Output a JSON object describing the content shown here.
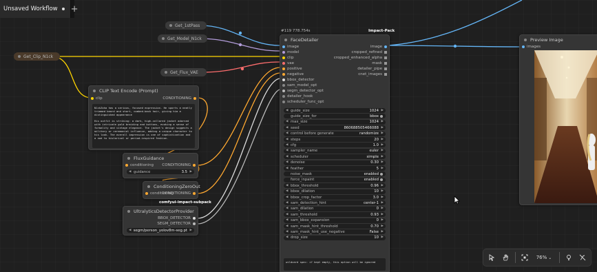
{
  "tab": {
    "title": "Unsaved Workflow",
    "add": "+"
  },
  "nodes": {
    "get_1stpass": {
      "title": "Get_1stPass"
    },
    "get_model": {
      "title": "Get_Model_N1ck"
    },
    "get_clip": {
      "title": "Get_Clip_N1ck"
    },
    "get_vae": {
      "title": "Get_Flux_VAE"
    },
    "clip_text": {
      "title": "CLIP Text Encode (Prompt)",
      "input": "clip",
      "output": "CONDITIONING",
      "text_p1": "N1ckZoha has a serious, focused expression. He sports a neatly trimmed beard and short, combed-back hair, giving him a distinguished appearance",
      "text_p2": "His outfit is striking: a dark, high-collared jacket adorned with intricate gold braiding and buttons, evoking a sense of formality and vintage elegance. The jacket's design suggests a military or ceremonial influence, adding a unique character to his look. The overall impression is one of sophistication and a nod to historical or period-inspired fashion."
    },
    "flux_guidance": {
      "title": "FluxGuidance",
      "input": "conditioning",
      "output": "CONDITIONING",
      "widget_label": "guidance",
      "widget_value": "3.5"
    },
    "cond_zero": {
      "title": "ConditioningZeroOut",
      "input": "conditioning",
      "output": "CONDITIONING"
    },
    "ultra": {
      "title": "UltralyticsDetectorProvider",
      "out1": "BBOX_DETECTOR",
      "out2": "SEGM_DETECTOR",
      "model": "segm/person_yolov8m-seg.pt"
    },
    "face": {
      "badge": "#119",
      "badge_time": "778.754s",
      "title": "FaceDetailer",
      "pack": "Impact-Pack",
      "inputs": [
        "image",
        "model",
        "clip",
        "vae",
        "positive",
        "negative",
        "bbox_detector",
        "sam_model_opt",
        "segm_detector_opt",
        "detailer_hook",
        "scheduler_func_opt"
      ],
      "outputs": [
        "image",
        "cropped_refined",
        "cropped_enhanced_alpha",
        "mask",
        "detailer_pipe",
        "cnet_images"
      ],
      "widgets": [
        {
          "label": "guide_size",
          "value": "1024"
        },
        {
          "label": "guide_size_for",
          "value": "bbox"
        },
        {
          "label": "max_size",
          "value": "1024"
        },
        {
          "label": "seed",
          "value": "860688505466088"
        },
        {
          "label": "control before generate",
          "value": "randomize"
        },
        {
          "label": "steps",
          "value": "20"
        },
        {
          "label": "cfg",
          "value": "1.0"
        },
        {
          "label": "sampler_name",
          "value": "euler"
        },
        {
          "label": "scheduler",
          "value": "simple"
        },
        {
          "label": "denoise",
          "value": "0.30"
        },
        {
          "label": "feather",
          "value": "5"
        },
        {
          "label": "noise_mask",
          "value": "enabled"
        },
        {
          "label": "force_inpaint",
          "value": "enabled"
        },
        {
          "label": "bbox_threshold",
          "value": "0.96"
        },
        {
          "label": "bbox_dilation",
          "value": "10"
        },
        {
          "label": "bbox_crop_factor",
          "value": "3.0"
        },
        {
          "label": "sam_detection_hint",
          "value": "center-1"
        },
        {
          "label": "sam_dilation",
          "value": "0"
        },
        {
          "label": "sam_threshold",
          "value": "0.93"
        },
        {
          "label": "sam_bbox_expansion",
          "value": "0"
        },
        {
          "label": "sam_mask_hint_threshold",
          "value": "0.70"
        },
        {
          "label": "sam_mask_hint_use_negative",
          "value": "False"
        },
        {
          "label": "drop_size",
          "value": "10"
        }
      ],
      "wildcard_placeholder": "wildcard spec: if kept empty, this option will be ignored"
    },
    "preview": {
      "title": "Preview Image",
      "input": "images"
    }
  },
  "group_label": "comfyui-impact-subpack",
  "toolbar": {
    "zoom": "76%",
    "zoom_caret": "⌄"
  },
  "colors": {
    "image_wire": "#64b5f6",
    "model_wire": "#b39ddb",
    "clip_wire": "#ffd500",
    "vae_wire": "#ff6e6e",
    "conditioning_wire": "#ffa931",
    "detector_wire": "#dddddd"
  }
}
